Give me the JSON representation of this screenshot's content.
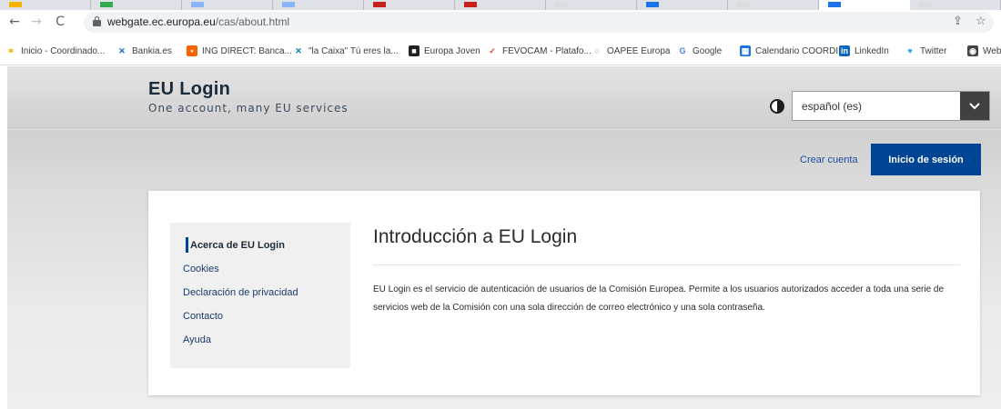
{
  "browser": {
    "url_host": "webgate.ec.europa.eu",
    "url_path": "/cas/about.html",
    "tab_favicon_colors": [
      "#f4b400",
      "#34a853",
      "#8ab4f8",
      "#8ab4f8",
      "#c5221f",
      "#c5221f",
      "#dadce0",
      "#1a73e8",
      "#dadce0",
      "#1a73e8",
      "#dadce0"
    ]
  },
  "bookmarks": [
    {
      "label": "Inicio - Coordinado...",
      "icon": "figure-icon",
      "color": "#f4b400"
    },
    {
      "label": "Bankia.es",
      "icon": "bankia-icon",
      "color": "#1565c0"
    },
    {
      "label": "ING DIRECT: Banca...",
      "icon": "ing-icon",
      "color": "#ff6200"
    },
    {
      "label": "\"la Caixa\" Tú eres la...",
      "icon": "caixa-icon",
      "color": "#007eae"
    },
    {
      "label": "Europa Joven",
      "icon": "europa-joven-icon",
      "color": "#222222"
    },
    {
      "label": "FEVOCAM - Platafo...",
      "icon": "fevocam-icon",
      "color": "#e53935"
    },
    {
      "label": "OAPEE Europa",
      "icon": "oapee-icon",
      "color": "#29b6f6"
    },
    {
      "label": "Google",
      "icon": "google-icon",
      "color": "#4285f4"
    },
    {
      "label": "Calendario COORDI",
      "icon": "calendar-icon",
      "color": "#1a73e8"
    },
    {
      "label": "LinkedIn",
      "icon": "linkedin-icon",
      "color": "#0a66c2"
    },
    {
      "label": "Twitter",
      "icon": "twitter-icon",
      "color": "#1da1f2"
    },
    {
      "label": "Web",
      "icon": "web-icon",
      "color": "#444444"
    }
  ],
  "header": {
    "title": "EU Login",
    "subtitle": "One account, many EU services",
    "language_value": "español (es)",
    "create_account": "Crear cuenta",
    "login_button": "Inicio de sesión"
  },
  "sidenav": {
    "items": [
      {
        "label": "Acerca de EU Login",
        "active": true
      },
      {
        "label": "Cookies",
        "active": false
      },
      {
        "label": "Declaración de privacidad",
        "active": false
      },
      {
        "label": "Contacto",
        "active": false
      },
      {
        "label": "Ayuda",
        "active": false
      }
    ]
  },
  "content": {
    "title": "Introducción a EU Login",
    "body": "EU Login es el servicio de autenticación de usuarios de la Comisión Europea. Permite a los usuarios autorizados acceder a toda una serie de servicios web de la Comisión con una sola dirección de correo electrónico y una sola contraseña."
  },
  "colors": {
    "primary": "#004494",
    "link": "#1a4fa0"
  }
}
